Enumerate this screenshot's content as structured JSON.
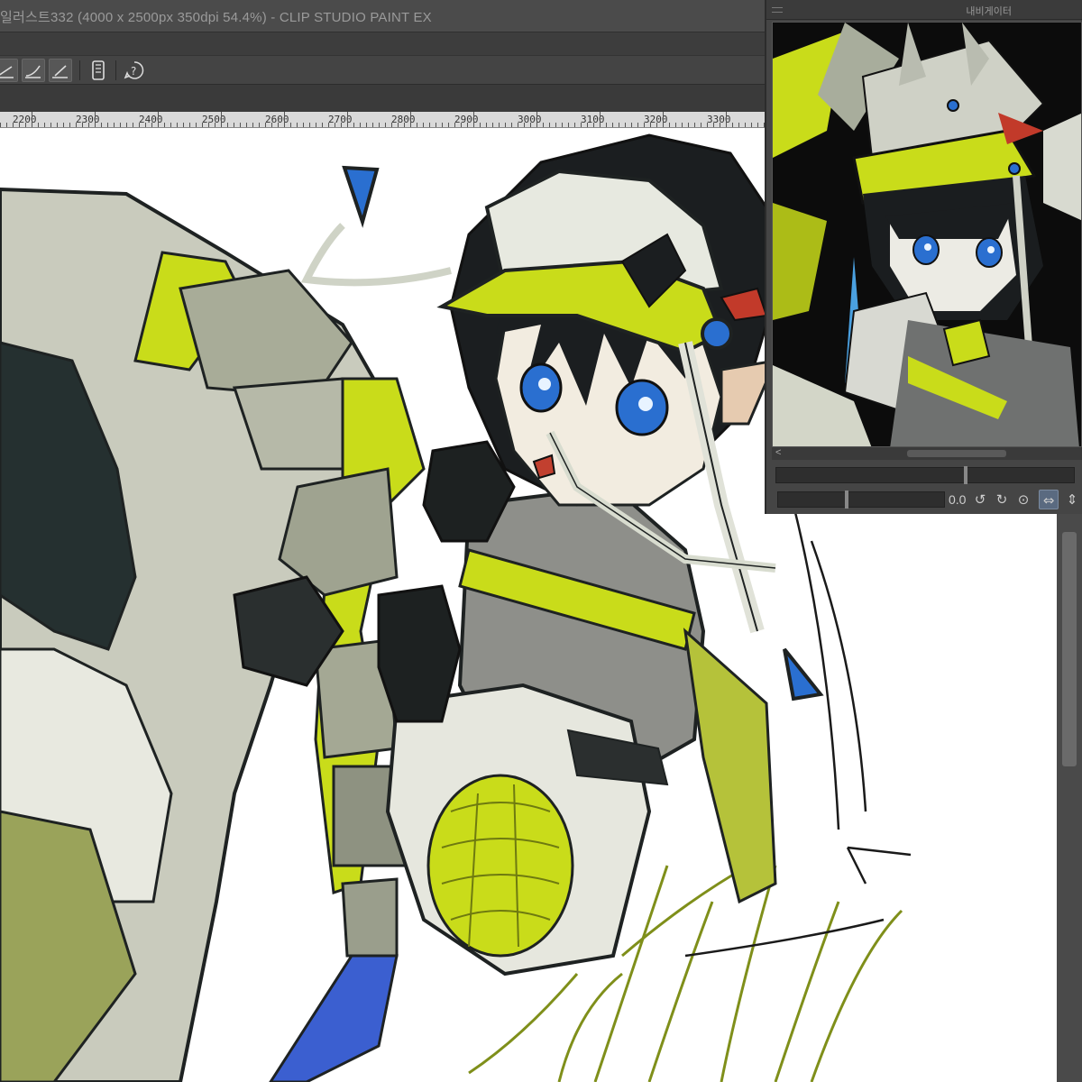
{
  "window": {
    "title": "일러스트332 (4000 x 2500px 350dpi 54.4%)  - CLIP STUDIO PAINT EX"
  },
  "ruler": {
    "labels": [
      "2200",
      "2300",
      "2400",
      "2500",
      "2600",
      "2700",
      "2800",
      "2900",
      "3000",
      "3100",
      "3200",
      "3300"
    ]
  },
  "navigator": {
    "panel_name": "내비게이터",
    "rotation_value": "0.0",
    "left_arrow": "<",
    "buttons": {
      "rotate_left": "↺",
      "rotate_right": "↻",
      "reset_rotation": "⊙",
      "flip_horizontal": "⇔",
      "flip_vertical": "⇕"
    }
  },
  "icons": {
    "toolbar": [
      "pen-stroke-icon",
      "brush-stroke-icon",
      "line-stroke-icon",
      "smartphone-icon",
      "help-icon"
    ]
  },
  "colors": {
    "accent_lime": "#c9dc1a",
    "armor_gray": "#b8bcac",
    "dark_line": "#1e2222",
    "eye_blue": "#2a6fd0"
  }
}
